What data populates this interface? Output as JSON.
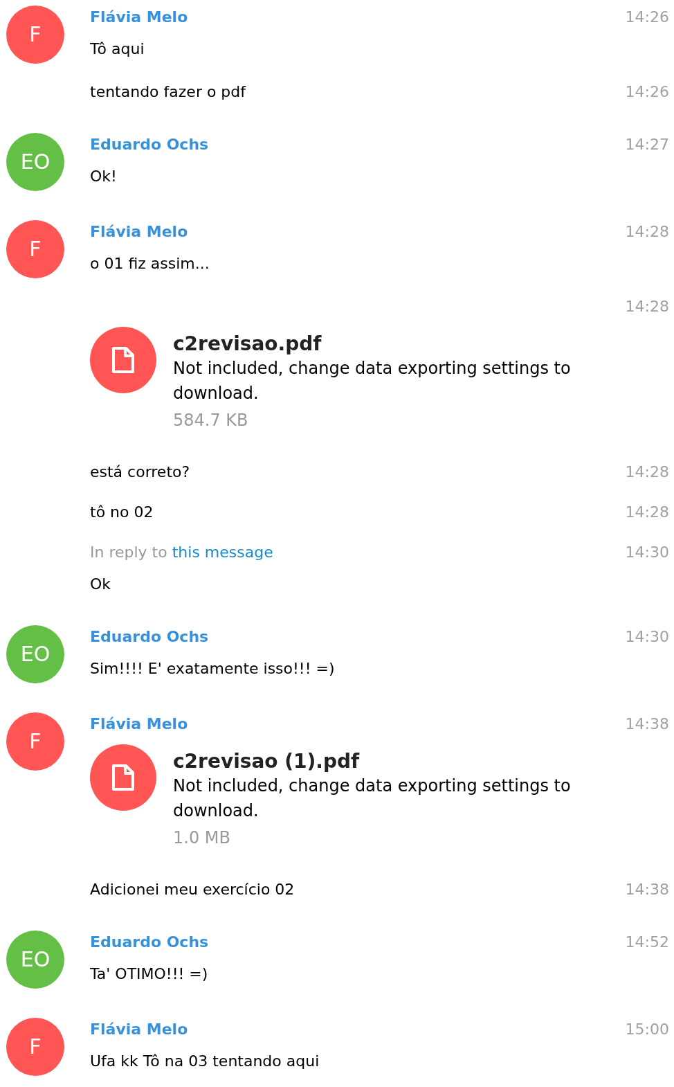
{
  "messages": [
    {
      "kind": "default",
      "author": "Flávia Melo",
      "initials": "F",
      "color": "#ff5555",
      "time": "14:26",
      "text": "Tô aqui"
    },
    {
      "kind": "joined",
      "time": "14:26",
      "text": "tentando fazer o pdf"
    },
    {
      "kind": "default",
      "author": "Eduardo Ochs",
      "initials": "EO",
      "color": "#64bf47",
      "time": "14:27",
      "text": "Ok!"
    },
    {
      "kind": "default",
      "author": "Flávia Melo",
      "initials": "F",
      "color": "#ff5555",
      "time": "14:28",
      "text": "o 01 fiz assim..."
    },
    {
      "kind": "joined",
      "time": "14:28",
      "file": {
        "name": "c2revisao.pdf",
        "note": "Not included, change data exporting settings to download.",
        "size": "584.7 KB"
      }
    },
    {
      "kind": "joined",
      "time": "14:28",
      "text": "está correto?"
    },
    {
      "kind": "joined",
      "time": "14:28",
      "text": "tô no 02"
    },
    {
      "kind": "joined",
      "time": "14:30",
      "reply": {
        "prefix": "In reply to",
        "link": "this message"
      },
      "text": "Ok"
    },
    {
      "kind": "default",
      "author": "Eduardo Ochs",
      "initials": "EO",
      "color": "#64bf47",
      "time": "14:30",
      "text": "Sim!!!! E' exatamente isso!!! =)"
    },
    {
      "kind": "default",
      "author": "Flávia Melo",
      "initials": "F",
      "color": "#ff5555",
      "time": "14:38",
      "file": {
        "name": "c2revisao (1).pdf",
        "note": "Not included, change data exporting settings to download.",
        "size": "1.0 MB"
      }
    },
    {
      "kind": "joined",
      "time": "14:38",
      "text": "Adicionei meu exercício 02"
    },
    {
      "kind": "default",
      "author": "Eduardo Ochs",
      "initials": "EO",
      "color": "#64bf47",
      "time": "14:52",
      "text": "Ta' OTIMO!!! =)"
    },
    {
      "kind": "default",
      "author": "Flávia Melo",
      "initials": "F",
      "color": "#ff5555",
      "time": "15:00",
      "text": "Ufa kk Tô na 03 tentando aqui"
    }
  ]
}
